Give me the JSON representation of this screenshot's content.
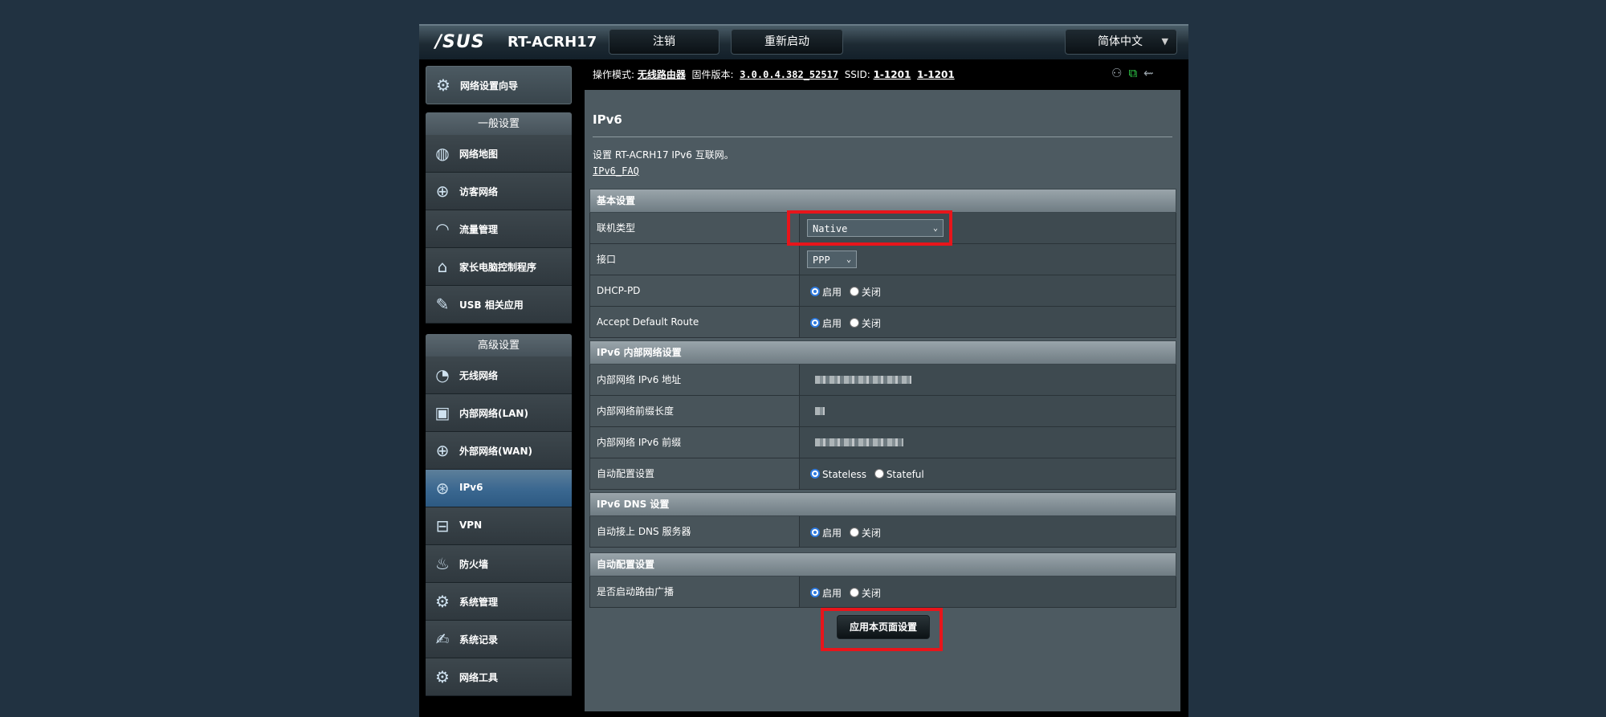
{
  "header": {
    "logo": "/SUS",
    "model": "RT-ACRH17",
    "logout_label": "注销",
    "reboot_label": "重新启动",
    "language": "简体中文"
  },
  "status": {
    "mode_label": "操作模式:",
    "mode_value": "无线路由器",
    "firmware_label": "固件版本:",
    "firmware_value": "3.0.0.4.382_52517",
    "ssid_label": "SSID:",
    "ssid_1": "1-1201",
    "ssid_2": "1-1201"
  },
  "sidebar": {
    "wizard": {
      "label": "网络设置向导",
      "icon": "wizard-icon"
    },
    "general_header": "一般设置",
    "general_items": [
      {
        "label": "网络地图",
        "icon": "network-map-icon"
      },
      {
        "label": "访客网络",
        "icon": "guest-network-icon"
      },
      {
        "label": "流量管理",
        "icon": "traffic-icon"
      },
      {
        "label": "家长电脑控制程序",
        "icon": "parental-lock-icon"
      },
      {
        "label": "USB 相关应用",
        "icon": "usb-icon"
      }
    ],
    "advanced_header": "高级设置",
    "advanced_items": [
      {
        "label": "无线网络",
        "icon": "wireless-icon"
      },
      {
        "label": "内部网络(LAN)",
        "icon": "lan-icon"
      },
      {
        "label": "外部网络(WAN)",
        "icon": "wan-globe-icon"
      },
      {
        "label": "IPv6",
        "icon": "ipv6-icon",
        "active": true
      },
      {
        "label": "VPN",
        "icon": "vpn-icon"
      },
      {
        "label": "防火墙",
        "icon": "firewall-icon"
      },
      {
        "label": "系统管理",
        "icon": "admin-gear-icon"
      },
      {
        "label": "系统记录",
        "icon": "log-icon"
      },
      {
        "label": "网络工具",
        "icon": "network-tools-icon"
      }
    ]
  },
  "main": {
    "title": "IPv6",
    "description": "设置 RT-ACRH17 IPv6 互联网。",
    "faq_link": "IPv6_FAQ",
    "basic": {
      "header": "基本设置",
      "conn_type_label": "联机类型",
      "conn_type_value": "Native",
      "interface_label": "接口",
      "interface_value": "PPP",
      "dhcp_pd_label": "DHCP-PD",
      "accept_route_label": "Accept Default Route"
    },
    "lan": {
      "header": "IPv6 内部网络设置",
      "addr_label": "内部网络 IPv6 地址",
      "prefix_len_label": "内部网络前缀长度",
      "prefix_label": "内部网络 IPv6 前缀",
      "autoconf_label": "自动配置设置",
      "stateless": "Stateless",
      "stateful": "Stateful"
    },
    "dns": {
      "header": "IPv6 DNS 设置",
      "auto_dns_label": "自动接上 DNS 服务器"
    },
    "autoconf": {
      "header": "自动配置设置",
      "ra_label": "是否启动路由广播"
    },
    "enable": "启用",
    "disable": "关闭",
    "apply_label": "应用本页面设置"
  }
}
